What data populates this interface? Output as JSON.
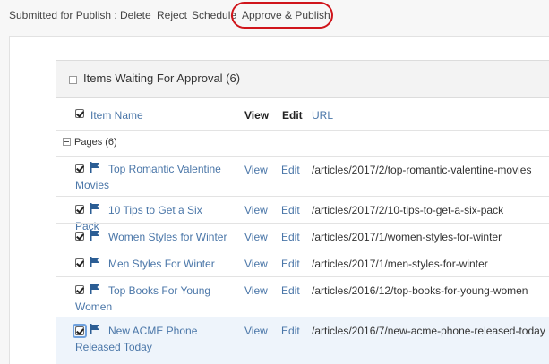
{
  "toolbar": {
    "label": "Submitted for Publish :",
    "delete": "Delete",
    "reject": "Reject",
    "schedule": "Schedule",
    "approve_publish": "Approve & Publish"
  },
  "panel": {
    "title": "Items Waiting For Approval (6)",
    "columns": {
      "name": "Item Name",
      "view": "View",
      "edit": "Edit",
      "url": "URL"
    },
    "group": "Pages (6)",
    "items": [
      {
        "name": "Top Romantic Valentine Movies",
        "view": "View",
        "edit": "Edit",
        "url": "/articles/2017/2/top-romantic-valentine-movies"
      },
      {
        "name": "10 Tips to Get a Six Pack",
        "view": "View",
        "edit": "Edit",
        "url": "/articles/2017/2/10-tips-to-get-a-six-pack"
      },
      {
        "name": "Women Styles for Winter",
        "view": "View",
        "edit": "Edit",
        "url": "/articles/2017/1/women-styles-for-winter"
      },
      {
        "name": "Men Styles For Winter",
        "view": "View",
        "edit": "Edit",
        "url": "/articles/2017/1/men-styles-for-winter"
      },
      {
        "name": "Top Books For Young Women",
        "view": "View",
        "edit": "Edit",
        "url": "/articles/2016/12/top-books-for-young-women"
      },
      {
        "name": "New ACME Phone Released Today",
        "view": "View",
        "edit": "Edit",
        "url": "/articles/2016/7/new-acme-phone-released-today"
      }
    ]
  },
  "icons": {
    "flag": "flag-icon",
    "collapse": "collapse-icon",
    "checkbox": "checkbox-icon"
  },
  "colors": {
    "link": "#4a76a8",
    "highlight_ring": "#d0151b",
    "flag": "#2b5d94"
  }
}
